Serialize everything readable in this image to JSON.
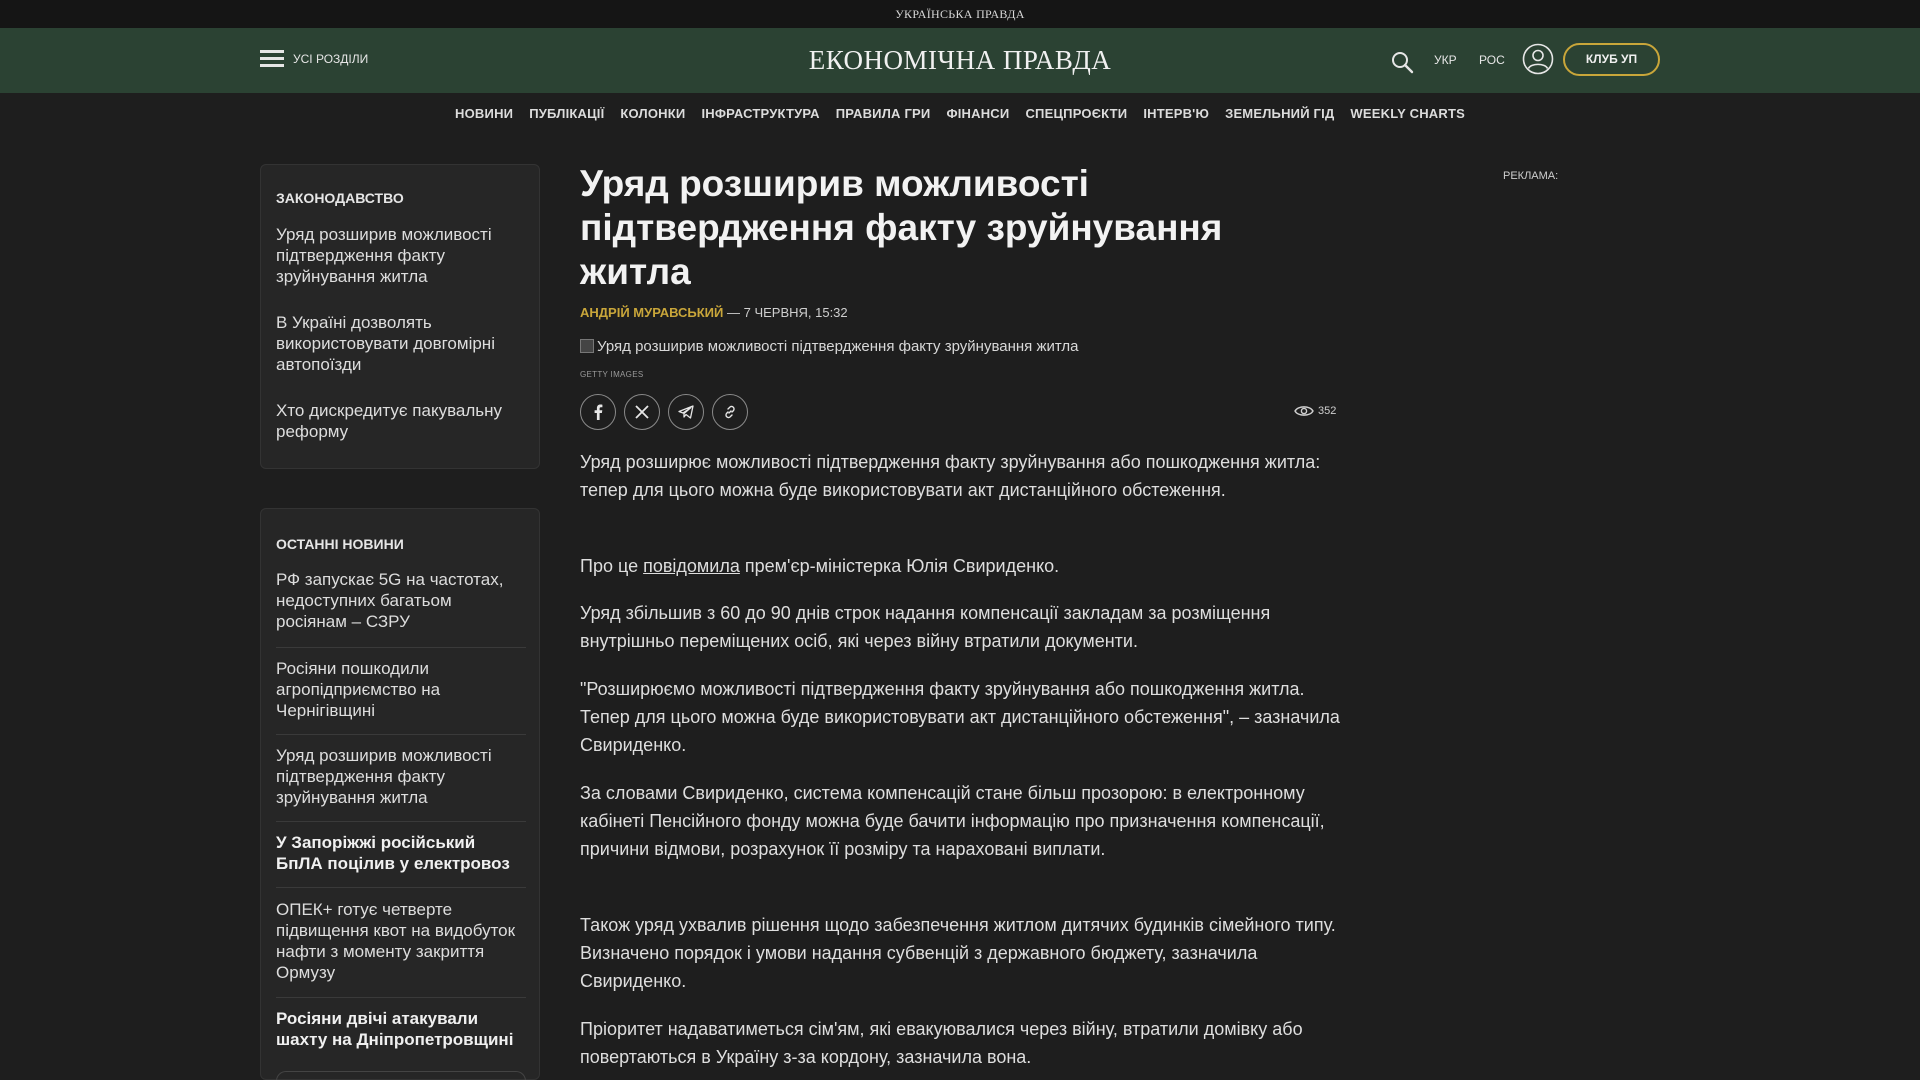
{
  "topbar": {
    "brand": "УКРАЇНСЬКА ПРАВДА"
  },
  "header": {
    "sections_label": "УСІ РОЗДІЛИ",
    "logo": "ЕКОНОМІЧНА ПРАВДА",
    "lang_ukr": "УКР",
    "lang_ros": "РОС",
    "club_button": "КЛУБ УП"
  },
  "nav": {
    "items": [
      "НОВИНИ",
      "ПУБЛІКАЦІЇ",
      "КОЛОНКИ",
      "ІНФРАСТРУКТУРА",
      "ПРАВИЛА ГРИ",
      "ФІНАНСИ",
      "СПЕЦПРОЄКТИ",
      "ІНТЕРВ'Ю",
      "ЗЕМЕЛЬНИЙ ГІД",
      "WEEKLY CHARTS"
    ]
  },
  "sidebar": {
    "legislation": {
      "title": "ЗАКОНОДАВСТВО",
      "items": [
        "Уряд розширив можливості підтвердження факту зруйнування житла",
        "В Україні дозволять використовувати довгомірні автопоїзди",
        "Хто дискредитує пакувальну реформу"
      ]
    },
    "latest": {
      "title": "ОСТАННІ НОВИНИ",
      "items": [
        "РФ запускає 5G на частотах, недоступних багатьом росіянам – СЗРУ",
        "Росіяни пошкодили агропідприємство на Чернігівщині",
        "Уряд розширив можливості підтвердження факту зруйнування житла",
        "У Запоріжжі російський БпЛА поцілив у електровоз",
        "ОПЕК+ готує четверте підвищення квот на видобуток нафти з моменту закриття Ормузу",
        "Росіяни двічі атакували шахту на Дніпропетровщині"
      ]
    }
  },
  "article": {
    "title": "Уряд розширив можливості підтвердження факту зруйнування житла",
    "author": "АНДРІЙ МУРАВСЬКИЙ",
    "date": "— 7 ЧЕРВНЯ, 15:32",
    "image_alt": "Уряд розширив можливості підтвердження факту зруйнування житла",
    "image_credit": "GETTY IMAGES",
    "views": "352",
    "p1": "Уряд розширює можливості підтвердження факту зруйнування або пошкодження житла: тепер для цього можна буде використовувати акт дистанційного обстеження.",
    "p2_before": "Про це ",
    "p2_link": "повідомила",
    "p2_after": " прем'єр-міністерка Юлія Свириденко.",
    "p3": "Уряд збільшив з 60 до 90 днів строк надання компенсації закладам за розміщення внутрішньо переміщених осіб, які через війну втратили документи.",
    "p4": "\"Розширюємо можливості підтвердження факту зруйнування або пошкодження житла. Тепер для цього можна буде використовувати акт дистанційного обстеження\", – зазначила Свириденко.",
    "p5": "За словами Свириденко, система компенсацій стане більш прозорою: в електронному кабінеті Пенсійного фонду можна буде бачити інформацію про призначення компенсації, причини відмови, розрахунок її розміру та нараховані виплати.",
    "p6": "Також уряд ухвалив рішення щодо забезпечення житлом дитячих будинків сімейного типу. Визначено порядок і умови надання субвенцій з державного бюджету, зазначила Свириденко.",
    "p7": "Пріоритет надаватиметься сім'ям, які евакуювалися через війну, втратили домівку або повертаються в Україну з-за кордону, зазначила вона."
  },
  "ad": {
    "label": "РЕКЛАМА:"
  }
}
